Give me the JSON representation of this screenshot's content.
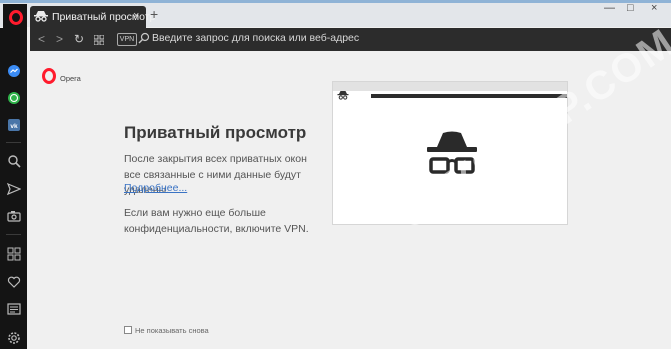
{
  "tab": {
    "title": "Приватный просмотр",
    "close": "×"
  },
  "new_tab": "+",
  "window_controls": {
    "minimize": "—",
    "maximize": "□",
    "close": "×"
  },
  "toolbar": {
    "back": "<",
    "forward": ">",
    "reload": "↻",
    "vpn": "VPN",
    "address_placeholder": "Введите запрос для поиска или веб-адрес"
  },
  "page": {
    "brand": "Opera",
    "heading": "Приватный просмотр",
    "paragraph1": "После закрытия всех приватных окон все связанные с ними данные будут удалены.",
    "more_link": "Подробнее...",
    "paragraph2": "Если вам нужно еще больше конфиденциальности, включите VPN.",
    "dont_show": "Не показывать снова"
  },
  "sidebar": {
    "icons": [
      "messenger-icon",
      "whatsapp-icon",
      "vk-icon",
      "search-icon",
      "send-icon",
      "camera-icon",
      "speed-dial-icon",
      "heart-icon",
      "news-icon",
      "settings-icon"
    ]
  },
  "colors": {
    "opera_red": "#ff1b2d",
    "sidebar": "#141414",
    "toolbar": "#2c2c2c",
    "link": "#3a73c4",
    "page_bg": "#f0f0f0"
  },
  "watermark": "SPYCOMP.COM"
}
